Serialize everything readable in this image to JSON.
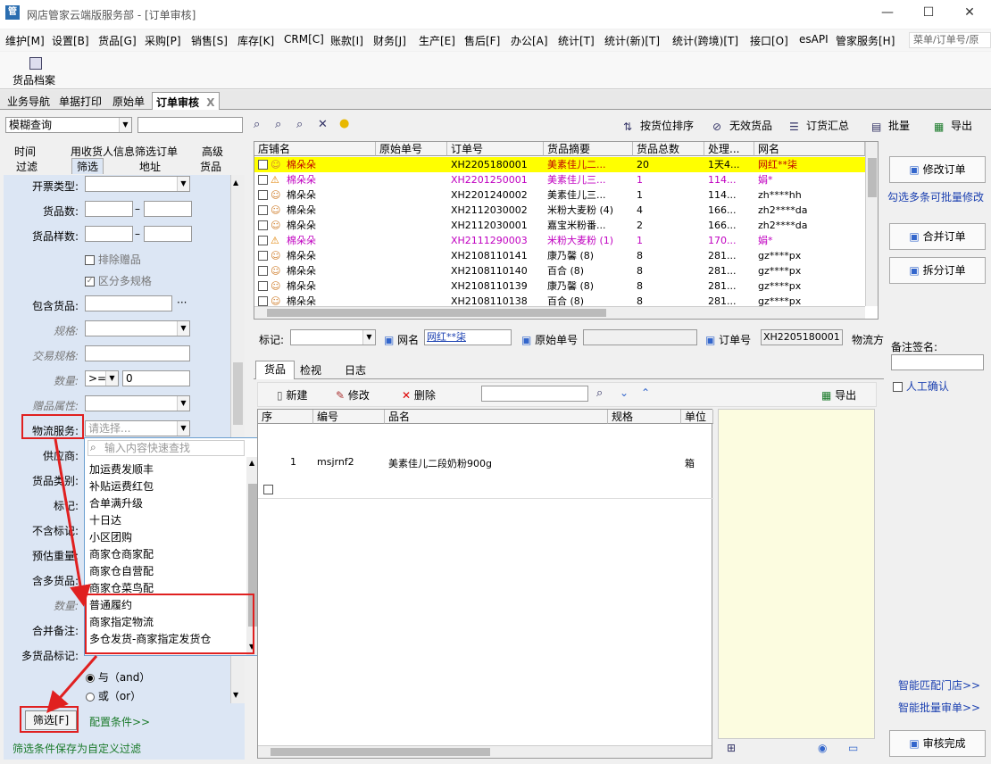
{
  "window": {
    "title": "网店管家云端版服务部 - [订单审核]",
    "app_icon": "管",
    "minimize": "—",
    "maximize": "☐",
    "close": "✕"
  },
  "menubar": {
    "items": [
      "维护[M]",
      "设置[B]",
      "货品[G]",
      "采购[P]",
      "销售[S]",
      "库存[K]",
      "CRM[C]",
      "账款[I]",
      "财务[J]",
      "生产[E]",
      "售后[F]",
      "办公[A]",
      "统计[T]",
      "统计(新)[T]",
      "统计(跨境)[T]",
      "接口[O]",
      "esAPI",
      "管家服务[H]"
    ],
    "search_placeholder": "菜单/订单号/原"
  },
  "toolbar1": {
    "goods_archive": "货品档案"
  },
  "doc_tabs": [
    {
      "label": "业务导航"
    },
    {
      "label": "单据打印"
    },
    {
      "label": "原始单"
    },
    {
      "label": "订单审核",
      "close": "X"
    }
  ],
  "toolbar2": {
    "query_mode": "模糊查询",
    "sort_by_location": "按货位排序",
    "invalid_goods": "无效货品",
    "order_summary": "订货汇总",
    "batch": "批量",
    "export": "导出"
  },
  "filter_tabs": {
    "row1": [
      "时间",
      "用收货人信息筛选订单",
      "高级"
    ],
    "row2": [
      "过滤",
      "筛选",
      "地址",
      "货品"
    ]
  },
  "filter_form": {
    "invoice_type": "开票类型:",
    "goods_count": "货品数:",
    "goods_kinds": "货品样数:",
    "range_dash": "–",
    "exclude_gifts": "排除赠品",
    "distinguish_spec": "区分多规格",
    "contains_goods": "包含货品:",
    "ellipsis": "···",
    "spec": "规格:",
    "trade_spec": "交易规格:",
    "quantity": "数量:",
    "quantity_op": ">=",
    "quantity_value": "0",
    "gift_attr": "赠品属性:",
    "logistics_service": "物流服务:",
    "logistics_placeholder": "请选择...",
    "supplier": "供应商:",
    "goods_category": "货品类别:",
    "tag": "标记:",
    "exclude_tag": "不含标记:",
    "est_weight": "预估重量:",
    "multi_goods": "含多货品:",
    "quantity2": "数量:",
    "merge_note": "合并备注:",
    "multi_goods_tag": "多货品标记:",
    "and_label": "与（and）",
    "or_label": "或（or）",
    "filter_button": "筛选[F]",
    "config_conditions": "配置条件>>",
    "save_filter_hint": "筛选条件保存为自定义过滤"
  },
  "logistics_dropdown": {
    "search_placeholder": "输入内容快速查找",
    "options": [
      "加运费发顺丰",
      "补贴运费红包",
      "合单满升级",
      "十日达",
      "小区团购",
      "商家仓商家配",
      "商家仓自营配",
      "商家仓菜鸟配",
      "普通履约",
      "商家指定物流",
      "多仓发货-商家指定发货仓"
    ]
  },
  "order_grid": {
    "columns": [
      "店铺名",
      "原始单号",
      "订单号",
      "货品摘要",
      "货品总数",
      "处理...",
      "网名"
    ],
    "rows": [
      {
        "shop": "棉朵朵",
        "raw": "",
        "order": "XH2205180001",
        "goods": "美素佳儿二...",
        "count": "20",
        "proc": "1天4...",
        "nick": "网红**柒",
        "style": "selected"
      },
      {
        "shop": "棉朵朵",
        "raw": "",
        "order": "XH2201250001",
        "goods": "美素佳儿三...",
        "count": "1",
        "proc": "114...",
        "nick": "娟*",
        "style": "magenta"
      },
      {
        "shop": "棉朵朵",
        "raw": "",
        "order": "XH2201240002",
        "goods": "美素佳儿三...",
        "count": "1",
        "proc": "114...",
        "nick": "zh****hh",
        "style": "normal"
      },
      {
        "shop": "棉朵朵",
        "raw": "",
        "order": "XH2112030002",
        "goods": "米粉大麦粉 (4)",
        "count": "4",
        "proc": "166...",
        "nick": "zh2****da",
        "style": "normal"
      },
      {
        "shop": "棉朵朵",
        "raw": "",
        "order": "XH2112030001",
        "goods": "嘉宝米粉番...",
        "count": "2",
        "proc": "166...",
        "nick": "zh2****da",
        "style": "normal"
      },
      {
        "shop": "棉朵朵",
        "raw": "",
        "order": "XH2111290003",
        "goods": "米粉大麦粉 (1)",
        "count": "1",
        "proc": "170...",
        "nick": "娟*",
        "style": "magenta"
      },
      {
        "shop": "棉朵朵",
        "raw": "",
        "order": "XH2108110141",
        "goods": "康乃馨 (8)",
        "count": "8",
        "proc": "281...",
        "nick": "gz****px",
        "style": "normal"
      },
      {
        "shop": "棉朵朵",
        "raw": "",
        "order": "XH2108110140",
        "goods": "百合 (8)",
        "count": "8",
        "proc": "281...",
        "nick": "gz****px",
        "style": "normal"
      },
      {
        "shop": "棉朵朵",
        "raw": "",
        "order": "XH2108110139",
        "goods": "康乃馨 (8)",
        "count": "8",
        "proc": "281...",
        "nick": "gz****px",
        "style": "normal"
      },
      {
        "shop": "棉朵朵",
        "raw": "",
        "order": "XH2108110138",
        "goods": "百合 (8)",
        "count": "8",
        "proc": "281...",
        "nick": "gz****px",
        "style": "normal"
      }
    ]
  },
  "info_bar": {
    "tag_label": "标记:",
    "nick_label": "网名",
    "nick_value": "网红**柒",
    "raw_order_label": "原始单号",
    "order_label": "订单号",
    "order_value": "XH2205180001",
    "logistics_label": "物流方"
  },
  "detail_tabs": [
    "货品",
    "检视",
    "日志"
  ],
  "detail_toolbar": {
    "new": "新建",
    "edit": "修改",
    "delete": "删除",
    "export": "导出"
  },
  "detail_grid": {
    "columns": [
      "序",
      "编号",
      "品名",
      "规格",
      "单位"
    ],
    "rows": [
      {
        "seq": "1",
        "code": "msjrnf2",
        "name": "美素佳儿二段奶粉900g",
        "spec": "",
        "unit": "箱"
      }
    ]
  },
  "right_panel": {
    "edit_order": "修改订单",
    "batch_hint": "勾选多条可批量修改",
    "merge_order": "合并订单",
    "split_order": "拆分订单",
    "note_sign": "备注签名:",
    "manual_confirm": "人工确认",
    "smart_match_store": "智能匹配门店>>",
    "smart_batch_single": "智能批量审单>>",
    "review_done": "审核完成"
  },
  "colors": {
    "selected_row": "#ffff00",
    "magenta_text": "#c000c0",
    "form_bg": "#dce6f4",
    "highlight_red": "#e02020",
    "link_blue": "#1a3fb0",
    "note_area": "#fcfce0"
  }
}
